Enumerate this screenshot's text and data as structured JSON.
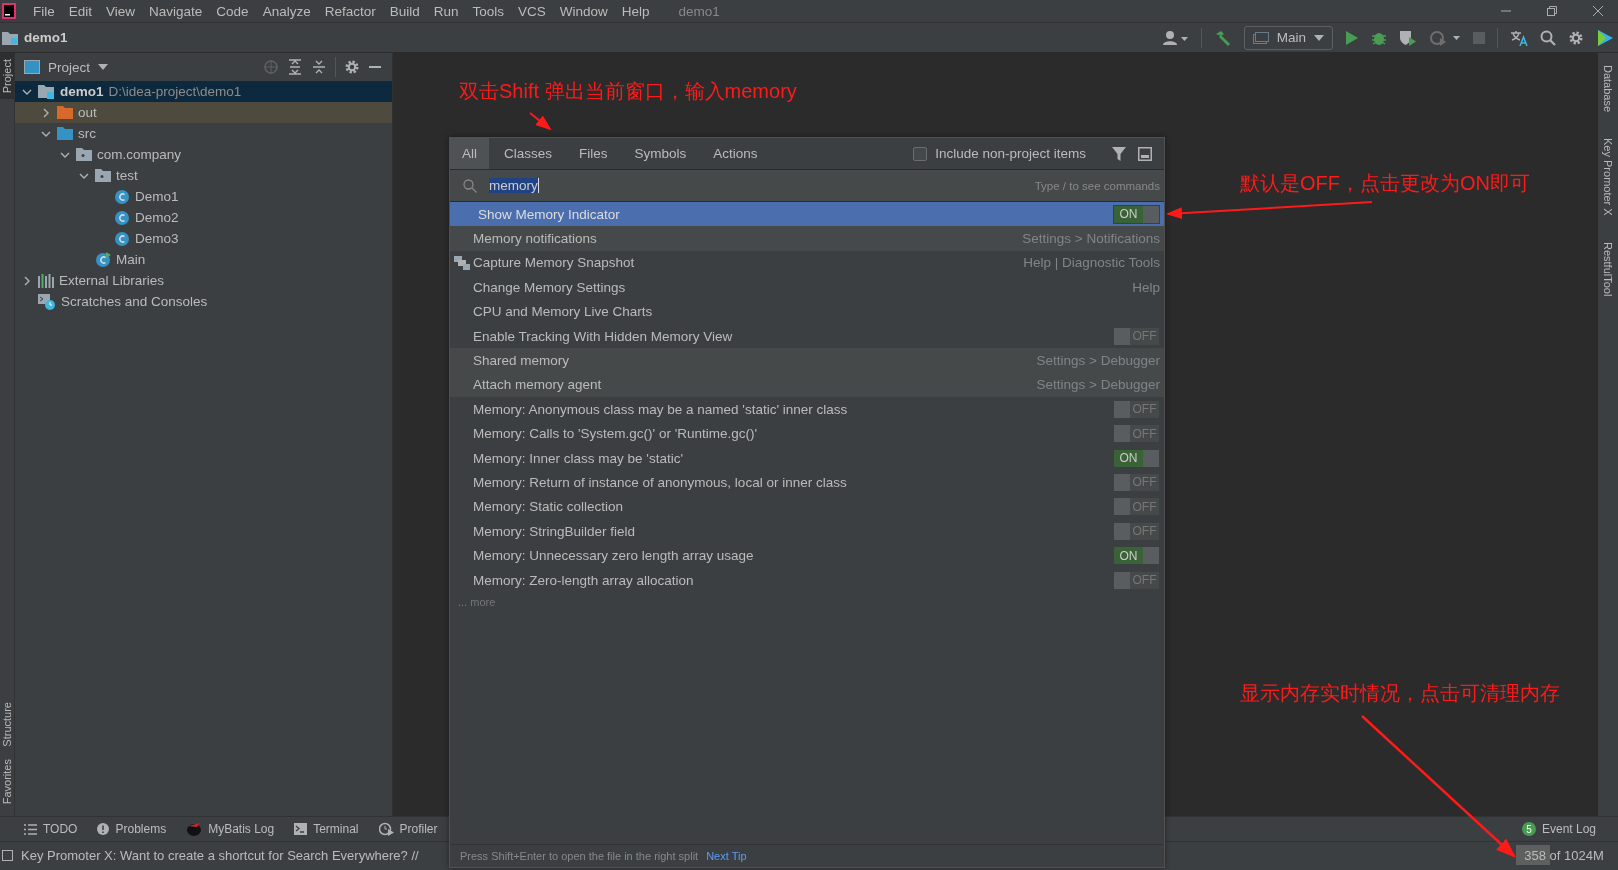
{
  "menu_bar": {
    "items": [
      "File",
      "Edit",
      "View",
      "Navigate",
      "Code",
      "Analyze",
      "Refactor",
      "Build",
      "Run",
      "Tools",
      "VCS",
      "Window",
      "Help"
    ],
    "title": "demo1"
  },
  "nav_bar": {
    "breadcrumb": "demo1",
    "run_config": "Main"
  },
  "left_stripe": {
    "top": [
      {
        "label": "Project",
        "selected": true
      }
    ],
    "bottom": [
      {
        "label": "Structure",
        "selected": false
      },
      {
        "label": "Favorites",
        "selected": false
      }
    ]
  },
  "right_stripe": [
    "Database",
    "Key Promoter X",
    "RestfulTool"
  ],
  "project_panel": {
    "title": "Project",
    "tree": [
      {
        "kind": "module",
        "label": "demo1",
        "path": "D:\\idea-project\\demo1",
        "selected": true,
        "expanded": true,
        "children": [
          {
            "kind": "excluded-folder",
            "label": "out",
            "selected": false,
            "expanded": false
          },
          {
            "kind": "source-folder",
            "label": "src",
            "selected": false,
            "expanded": true,
            "children": [
              {
                "kind": "package",
                "label": "com.company",
                "selected": false,
                "expanded": true,
                "children": [
                  {
                    "kind": "package",
                    "label": "test",
                    "selected": false,
                    "expanded": true,
                    "children": [
                      {
                        "kind": "class",
                        "label": "Demo1",
                        "selected": false
                      },
                      {
                        "kind": "class",
                        "label": "Demo2",
                        "selected": false
                      },
                      {
                        "kind": "class",
                        "label": "Demo3",
                        "selected": false
                      }
                    ]
                  },
                  {
                    "kind": "main-class",
                    "label": "Main",
                    "selected": false
                  }
                ]
              }
            ]
          }
        ]
      },
      {
        "kind": "libraries",
        "label": "External Libraries",
        "selected": false,
        "expanded": false
      },
      {
        "kind": "scratches",
        "label": "Scratches and Consoles",
        "selected": false
      }
    ]
  },
  "annotations": [
    {
      "text": "双击Shift 弹出当前窗口，输入memory"
    },
    {
      "text": "默认是OFF，点击更改为ON即可"
    },
    {
      "text": "显示内存实时情况，点击可清理内存"
    }
  ],
  "search_popup": {
    "tabs": [
      {
        "label": "All",
        "selected": true
      },
      {
        "label": "Classes",
        "selected": false
      },
      {
        "label": "Files",
        "selected": false
      },
      {
        "label": "Symbols",
        "selected": false
      },
      {
        "label": "Actions",
        "selected": false
      }
    ],
    "include_option": {
      "label": "Include non-project items",
      "checked": false
    },
    "query": "memory",
    "hint": "Type / to see commands",
    "results": [
      {
        "kind": "option",
        "label": "Show Memory Indicator",
        "selected": true,
        "toggle": {
          "on": true,
          "label": "ON"
        }
      },
      {
        "kind": "setting",
        "label": "Memory notifications",
        "hint": "Settings > Notifications",
        "selected": false
      },
      {
        "kind": "action-with-icon",
        "label": "Capture Memory Snapshot",
        "hint": "Help | Diagnostic Tools",
        "selected": false
      },
      {
        "kind": "action",
        "label": "Change Memory Settings",
        "hint": "Help",
        "selected": false
      },
      {
        "kind": "action",
        "label": "CPU and Memory Live Charts",
        "selected": false
      },
      {
        "kind": "option",
        "label": "Enable Tracking With Hidden Memory View",
        "selected": false,
        "toggle": {
          "on": false,
          "label": "OFF"
        }
      },
      {
        "kind": "setting",
        "label": "Shared memory",
        "hint": "Settings > Debugger",
        "selected": false
      },
      {
        "kind": "setting",
        "label": "Attach memory agent",
        "hint": "Settings > Debugger",
        "selected": false
      },
      {
        "kind": "option",
        "label": "Memory: Anonymous class may be a named 'static' inner class",
        "selected": false,
        "toggle": {
          "on": false,
          "label": "OFF"
        }
      },
      {
        "kind": "option",
        "label": "Memory: Calls to 'System.gc()' or 'Runtime.gc()'",
        "selected": false,
        "toggle": {
          "on": false,
          "label": "OFF"
        }
      },
      {
        "kind": "option",
        "label": "Memory: Inner class may be 'static'",
        "selected": false,
        "toggle": {
          "on": true,
          "label": "ON"
        }
      },
      {
        "kind": "option",
        "label": "Memory: Return of instance of anonymous, local or inner class",
        "selected": false,
        "toggle": {
          "on": false,
          "label": "OFF"
        }
      },
      {
        "kind": "option",
        "label": "Memory: Static collection",
        "selected": false,
        "toggle": {
          "on": false,
          "label": "OFF"
        }
      },
      {
        "kind": "option",
        "label": "Memory: StringBuilder field",
        "selected": false,
        "toggle": {
          "on": false,
          "label": "OFF"
        }
      },
      {
        "kind": "option",
        "label": "Memory: Unnecessary zero length array usage",
        "selected": false,
        "toggle": {
          "on": true,
          "label": "ON"
        }
      },
      {
        "kind": "option",
        "label": "Memory: Zero-length array allocation",
        "selected": false,
        "toggle": {
          "on": false,
          "label": "OFF"
        }
      }
    ],
    "more": "... more",
    "footer_hint": "Press Shift+Enter to open the file in the right split",
    "footer_link": "Next Tip"
  },
  "tool_windows": [
    {
      "kind": "todo",
      "label": "TODO"
    },
    {
      "kind": "problems",
      "label": "Problems"
    },
    {
      "kind": "mybatis",
      "label": "MyBatis Log"
    },
    {
      "kind": "terminal",
      "label": "Terminal"
    },
    {
      "kind": "profiler",
      "label": "Profiler"
    }
  ],
  "event_log": {
    "label": "Event Log",
    "badge": "5"
  },
  "status_bar": {
    "message": "Key Promoter X: Want to create a shortcut for Search Everywhere? //",
    "memory": {
      "reading": "358 of 1024M",
      "level": 0.35
    }
  }
}
